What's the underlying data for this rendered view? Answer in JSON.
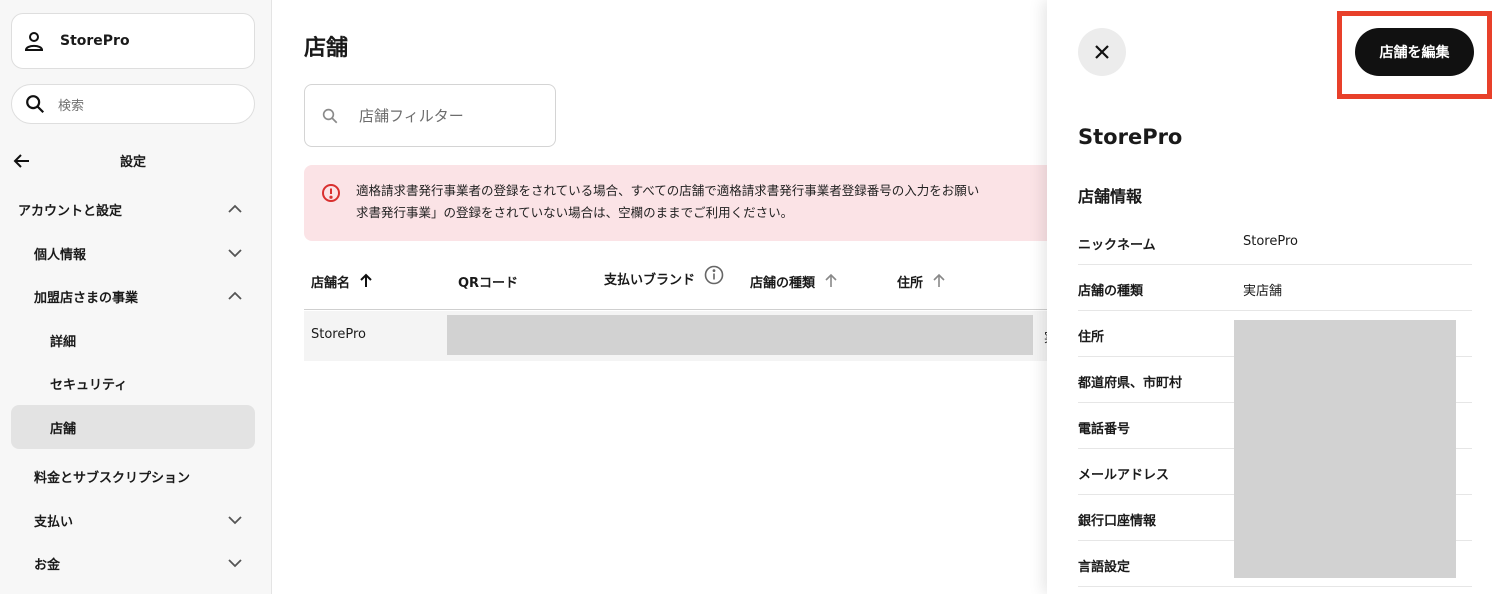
{
  "sidebar": {
    "store_name": "StorePro",
    "search_placeholder": "検索",
    "back_label": "設定",
    "items": [
      {
        "label": "アカウントと設定",
        "chevron": "chevron-up"
      },
      {
        "label": "個人情報",
        "chevron": "chevron-down"
      },
      {
        "label": "加盟店さまの事業",
        "chevron": "chevron-up"
      },
      {
        "label": "詳細"
      },
      {
        "label": "セキュリティ"
      },
      {
        "label": "店舗",
        "active": true
      },
      {
        "label": "料金とサブスクリプション"
      },
      {
        "label": "支払い",
        "chevron": "chevron-down"
      },
      {
        "label": "お金",
        "chevron": "chevron-down"
      }
    ]
  },
  "main": {
    "title": "店舗",
    "filter_placeholder": "店舗フィルター",
    "alert": {
      "line1": "適格請求書発行事業者の登録をされている場合、すべての店舗で適格請求書発行事業者登録番号の入力をお願い",
      "line2": "求書発行事業」の登録をされていない場合は、空欄のままでご利用ください。"
    },
    "table": {
      "headers": [
        "店舗名",
        "QRコード",
        "支払いブランド",
        "店舗の種類",
        "住所"
      ],
      "rows": [
        {
          "name": "StorePro",
          "cutoff": "実"
        }
      ]
    }
  },
  "panel": {
    "edit_label": "店舗を編集",
    "title": "StorePro",
    "section_title": "店舗情報",
    "fields": [
      {
        "label": "ニックネーム",
        "value": "StorePro"
      },
      {
        "label": "店舗の種類",
        "value": "実店舗"
      },
      {
        "label": "住所",
        "value": ""
      },
      {
        "label": "都道府県、市町村",
        "value": ""
      },
      {
        "label": "電話番号",
        "value": ""
      },
      {
        "label": "メールアドレス",
        "value": ""
      },
      {
        "label": "銀行口座情報",
        "value": ""
      },
      {
        "label": "言語設定",
        "value": ""
      }
    ]
  },
  "colors": {
    "alert_bg": "#fbe3e6",
    "alert_icon": "#d9302f",
    "highlight": "#e8402a",
    "button_bg": "#111111"
  }
}
